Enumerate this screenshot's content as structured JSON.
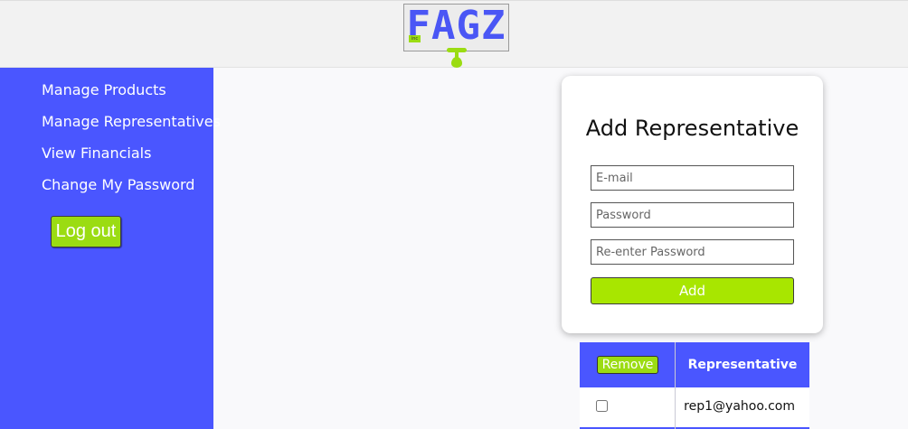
{
  "header": {
    "logo_text": "FAGZ",
    "logo_tag": "inc"
  },
  "sidebar": {
    "items": [
      {
        "label": "Manage Products"
      },
      {
        "label": "Manage Representatives"
      },
      {
        "label": "View Financials"
      },
      {
        "label": "Change My Password"
      }
    ],
    "logout_label": "Log out"
  },
  "form": {
    "title": "Add Representative",
    "email_placeholder": "E-mail",
    "password_placeholder": "Password",
    "reenter_placeholder": "Re-enter Password",
    "add_label": "Add"
  },
  "table": {
    "remove_label": "Remove",
    "column_header": "Representative",
    "rows": [
      {
        "email": "rep1@yahoo.com",
        "checked": false
      }
    ]
  },
  "colors": {
    "accent_blue": "#4a56ff",
    "accent_green": "#9bdc12",
    "background": "#f9f9fb"
  }
}
